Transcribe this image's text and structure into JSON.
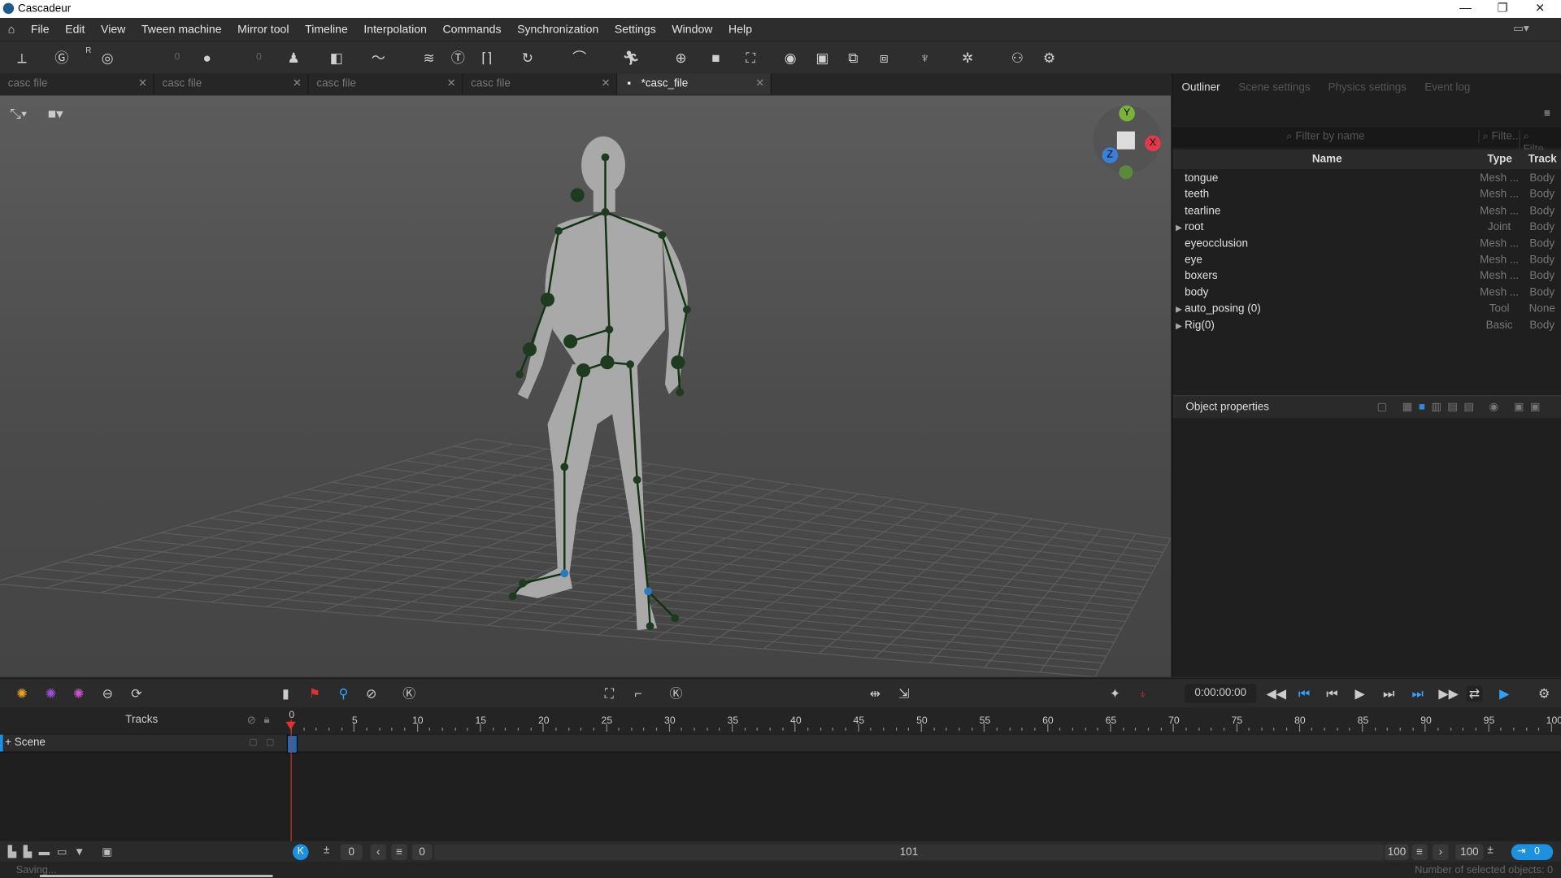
{
  "window": {
    "title": "Cascadeur",
    "min": "—",
    "max": "❐",
    "close": "✕"
  },
  "menu": [
    "File",
    "Edit",
    "View",
    "Tween machine",
    "Mirror tool",
    "Timeline",
    "Interpolation",
    "Commands",
    "Synchronization",
    "Settings",
    "Window",
    "Help"
  ],
  "toolbar": {
    "field_a": "0",
    "field_b": "0",
    "superscript_r": "R"
  },
  "tabs": [
    {
      "label": "casc file"
    },
    {
      "label": "casc file"
    },
    {
      "label": "casc file"
    },
    {
      "label": "casc file"
    },
    {
      "label": "*casc_file",
      "active": true
    }
  ],
  "gizmo": {
    "y": "Y",
    "x": "X",
    "z": "Z"
  },
  "right_panel": {
    "tabs": [
      "Outliner",
      "Scene settings",
      "Physics settings",
      "Event log"
    ],
    "filter_name_placeholder": "Filter by name",
    "filter_type_placeholder": "Filte...",
    "filter_track_placeholder": "Filte...",
    "columns": {
      "name": "Name",
      "type": "Type",
      "track": "Track"
    },
    "rows": [
      {
        "name": "tongue",
        "type": "Mesh ...",
        "track": "Body",
        "expandable": false
      },
      {
        "name": "teeth",
        "type": "Mesh ...",
        "track": "Body",
        "expandable": false
      },
      {
        "name": "tearline",
        "type": "Mesh ...",
        "track": "Body",
        "expandable": false
      },
      {
        "name": "root",
        "type": "Joint",
        "track": "Body",
        "expandable": true
      },
      {
        "name": "eyeocclusion",
        "type": "Mesh ...",
        "track": "Body",
        "expandable": false
      },
      {
        "name": "eye",
        "type": "Mesh ...",
        "track": "Body",
        "expandable": false
      },
      {
        "name": "boxers",
        "type": "Mesh ...",
        "track": "Body",
        "expandable": false
      },
      {
        "name": "body",
        "type": "Mesh ...",
        "track": "Body",
        "expandable": false
      },
      {
        "name": "auto_posing (0)",
        "type": "Tool",
        "track": "None",
        "expandable": true
      },
      {
        "name": "Rig(0)",
        "type": "Basic",
        "track": "Body",
        "expandable": true
      }
    ],
    "object_properties": "Object properties"
  },
  "timeline": {
    "time": "0:00:00:00",
    "tracks_label": "Tracks",
    "scene_label": "+ Scene",
    "ruler_labels": [
      "0",
      "5",
      "10",
      "15",
      "20",
      "25",
      "30",
      "35",
      "40",
      "45",
      "50",
      "55",
      "60",
      "65",
      "70",
      "75",
      "80",
      "85",
      "90",
      "95",
      "100"
    ],
    "current_frame": 0,
    "start_frame": "0",
    "range_start": "0",
    "frame_count": "101",
    "range_end": "100",
    "end_frame": "100",
    "key_counter": "0"
  },
  "status": {
    "left": "Saving...",
    "right": "Number of selected objects: 0"
  },
  "colors": {
    "accent": "#1e90e0",
    "playhead": "#e03030",
    "joint": "#1f3b1f",
    "bone": "#113311"
  }
}
